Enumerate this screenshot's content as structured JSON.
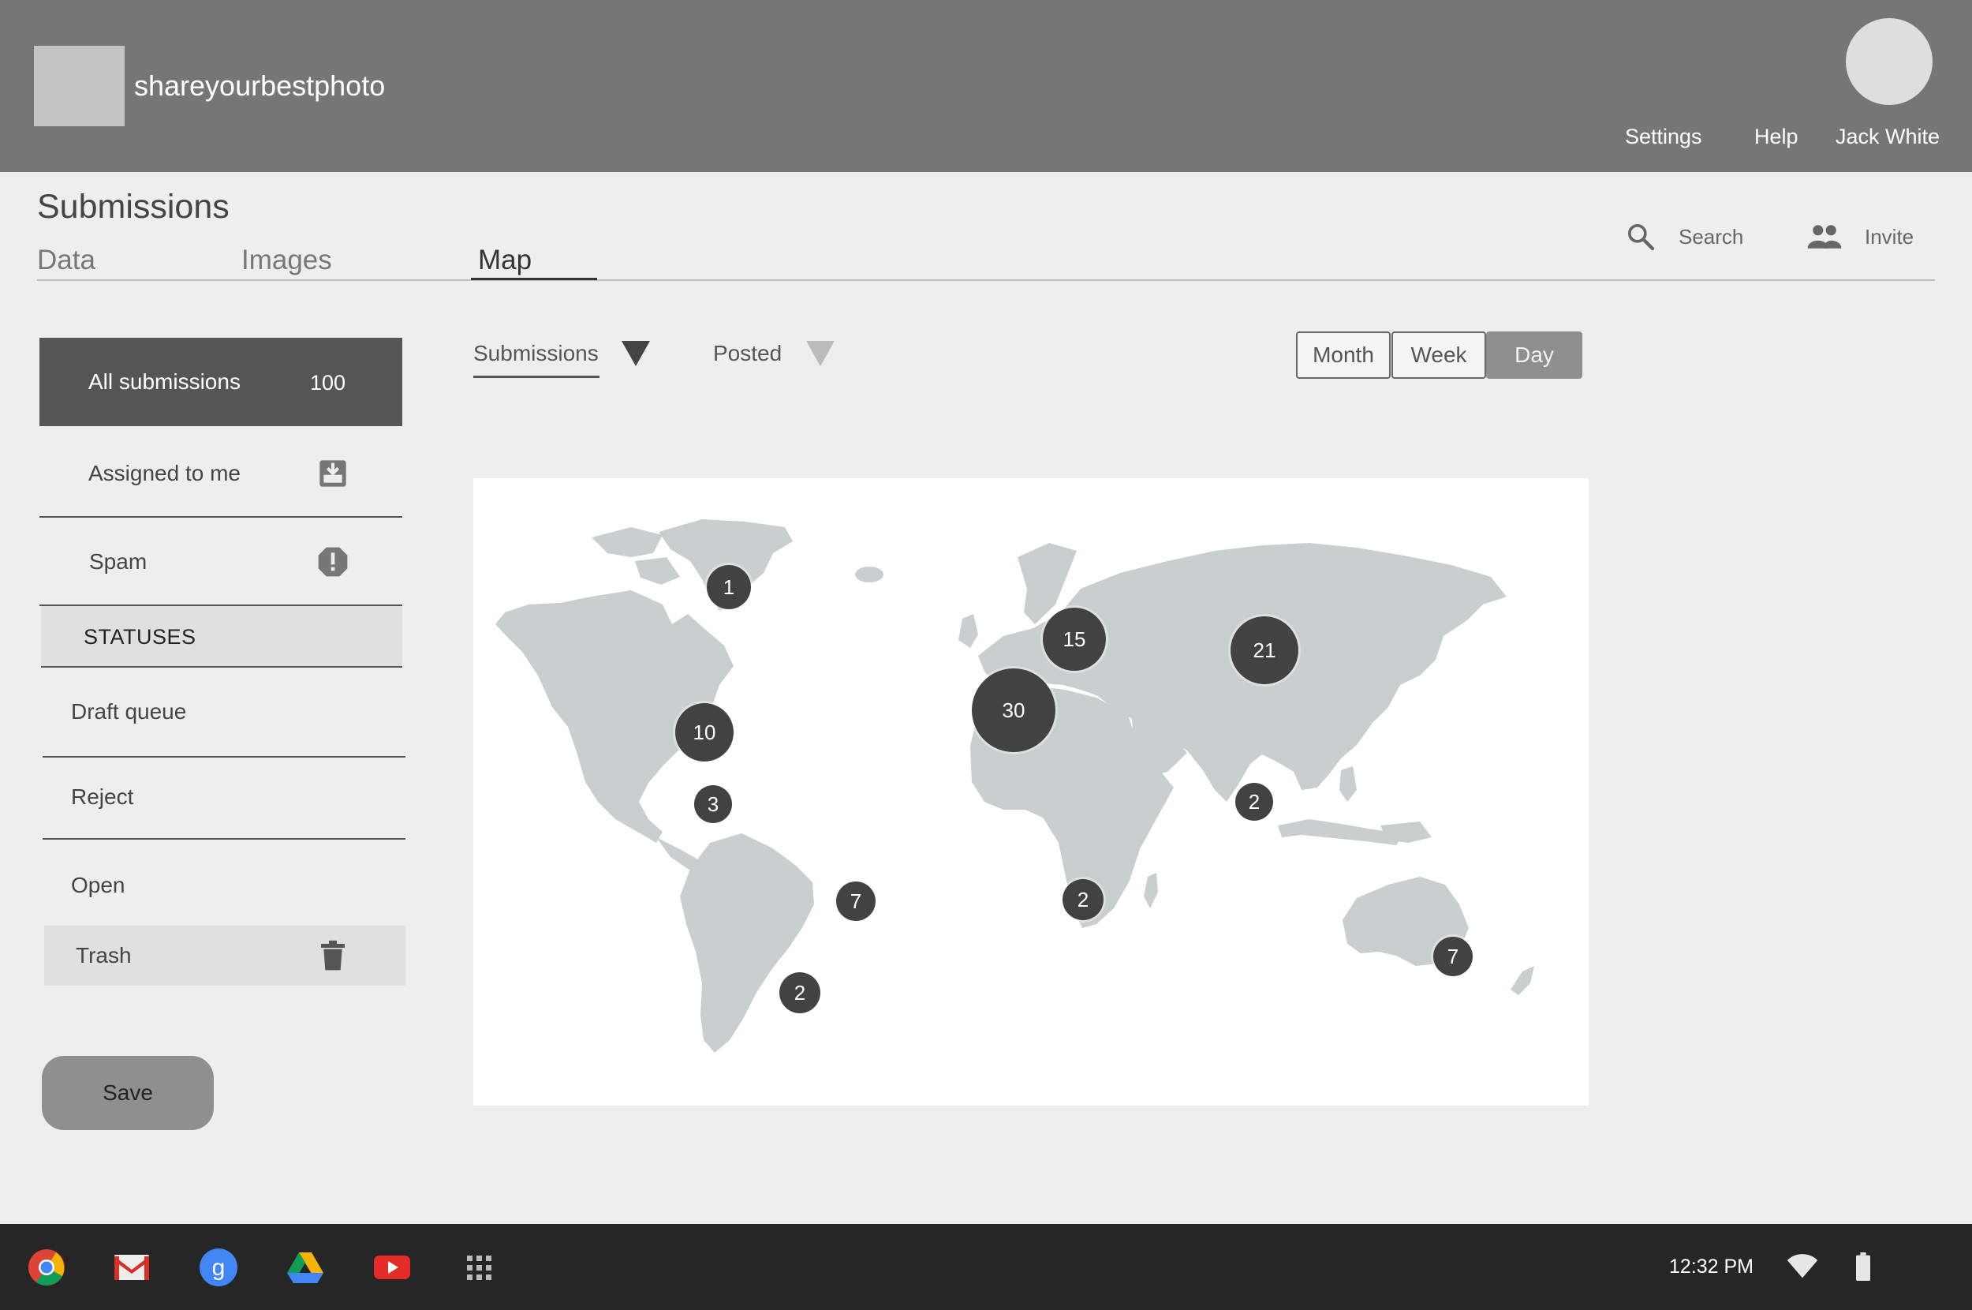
{
  "header": {
    "site_name": "shareyourbestphoto",
    "nav": {
      "settings": "Settings",
      "help": "Help",
      "user": "Jack White"
    }
  },
  "page": {
    "title": "Submissions",
    "tabs": [
      "Data",
      "Images",
      "Map"
    ],
    "active_tab": "Map"
  },
  "tools": {
    "search": "Search",
    "invite": "Invite"
  },
  "sidebar": {
    "all_submissions": {
      "label": "All submissions",
      "count": "100"
    },
    "assigned": "Assigned to me",
    "spam": "Spam",
    "statuses_header": "STATUSES",
    "statuses": [
      "Draft queue",
      "Reject",
      "Open",
      "Trash"
    ],
    "save": "Save"
  },
  "filters": {
    "submissions": "Submissions",
    "posted": "Posted",
    "range": [
      "Month",
      "Week",
      "Day"
    ],
    "active_range": "Day"
  },
  "map": {
    "clusters": [
      {
        "region": "Greenland",
        "count": "1"
      },
      {
        "region": "Scandinavia",
        "count": "15"
      },
      {
        "region": "Russia",
        "count": "21"
      },
      {
        "region": "Western Europe",
        "count": "30"
      },
      {
        "region": "United States",
        "count": "10"
      },
      {
        "region": "Mexico",
        "count": "3"
      },
      {
        "region": "India",
        "count": "2"
      },
      {
        "region": "Brazil",
        "count": "7"
      },
      {
        "region": "Southern Africa",
        "count": "2"
      },
      {
        "region": "Argentina",
        "count": "2"
      },
      {
        "region": "Australia",
        "count": "7"
      }
    ]
  },
  "taskbar": {
    "apps": [
      "chrome-icon",
      "gmail-icon",
      "google-plus-icon",
      "drive-icon",
      "youtube-icon",
      "apps-grid-icon"
    ],
    "time": "12:32 PM"
  },
  "colors": {
    "header_bg": "#767676",
    "sidebar_active": "#555555",
    "land": "#c9cfcf",
    "cluster": "#424242",
    "taskbar": "#262626"
  }
}
